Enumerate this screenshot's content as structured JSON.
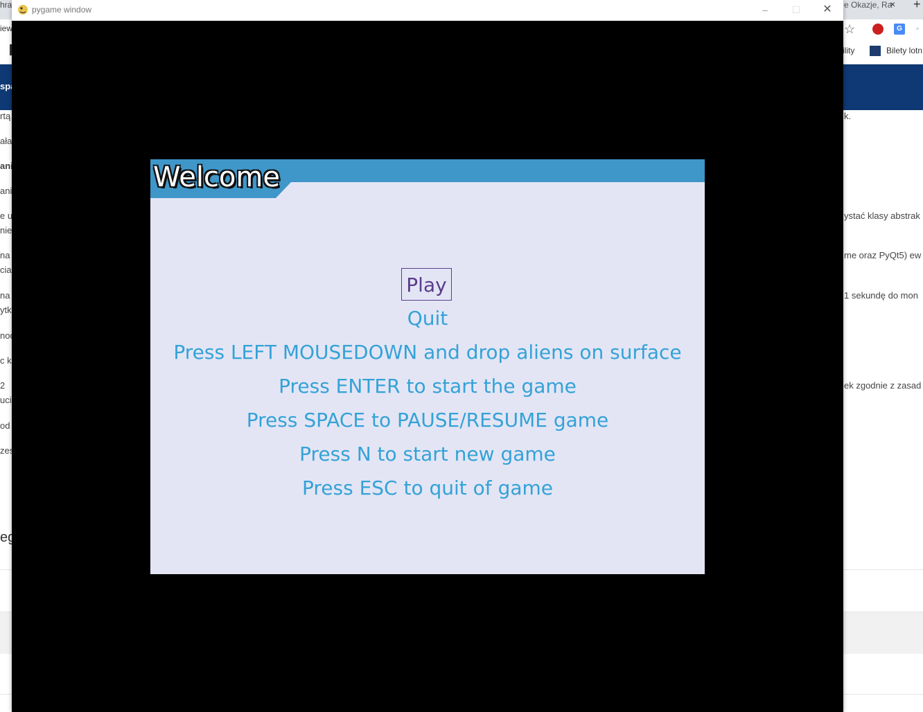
{
  "background": {
    "tab_left_text": "hra",
    "tab_right_text": "e Okazje, Ra",
    "tab_close": "×",
    "new_tab": "+",
    "toolbar_left": "iew",
    "bookmark_1": "ility",
    "bookmark_2": "Bilety lotn",
    "navbar_text": "spa",
    "left_lines": [
      "rtą",
      "ała",
      "ani",
      "ani",
      "e uż",
      "nies",
      "na",
      "cia",
      "na",
      "ytk",
      "nod",
      "c kr",
      "2",
      "ucie",
      "od",
      "zes"
    ],
    "right_lines": [
      "k.",
      "ystać klasy abstrak",
      "me oraz PyQt5) ew",
      "1 sekundę do mon",
      "ek zgodnie z zasad"
    ],
    "heading": "eg"
  },
  "window": {
    "title": "pygame window",
    "minimize": "–",
    "maximize": "☐",
    "close": "✕"
  },
  "menu": {
    "title": "Welcome",
    "play": "Play",
    "quit": "Quit",
    "instructions": [
      "Press LEFT MOUSEDOWN and drop aliens on surface",
      "Press ENTER to start the game",
      "Press SPACE to PAUSE/RESUME game",
      "Press N to start new game",
      "Press ESC to quit of game"
    ],
    "colors": {
      "panel_bg": "#e3e5f5",
      "title_bar": "#3f96c8",
      "item_text": "#34a2d6",
      "selected_text": "#5a3d8a"
    }
  }
}
